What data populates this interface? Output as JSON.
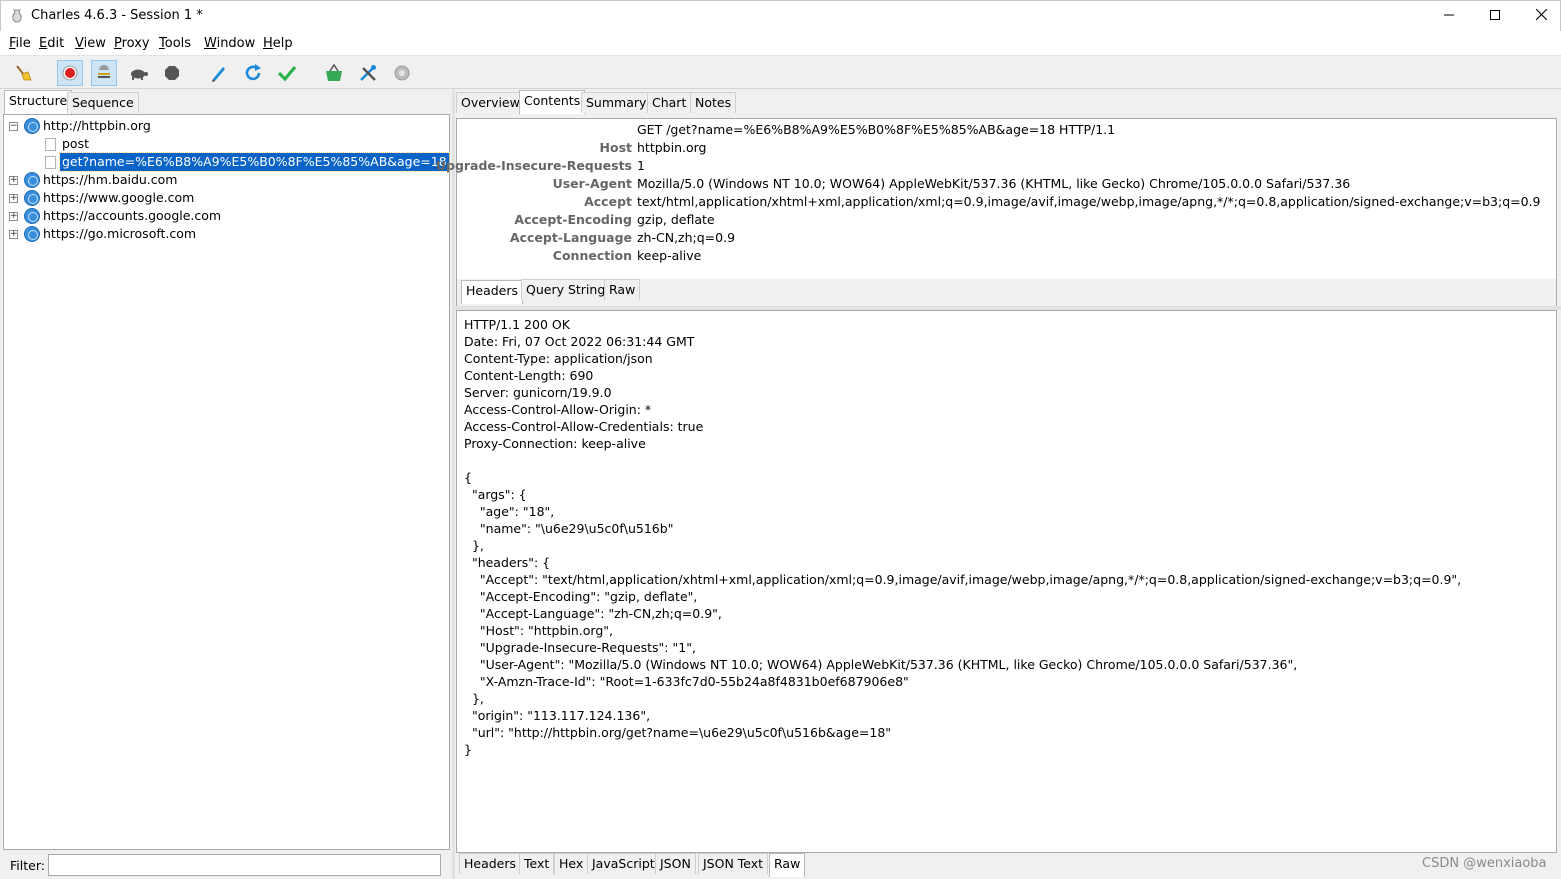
{
  "window": {
    "title": "Charles 4.6.3 - Session 1 *",
    "controls": [
      "minimize",
      "maximize",
      "close"
    ]
  },
  "menubar": [
    "File",
    "Edit",
    "View",
    "Proxy",
    "Tools",
    "Window",
    "Help"
  ],
  "toolbar": {
    "icons": [
      "broom-icon",
      "record-icon",
      "throttle-icon",
      "turtle-icon",
      "stop-hexagon-icon",
      "pen-icon",
      "refresh-icon",
      "check-icon",
      "basket-icon",
      "tools-icon",
      "settings-gear-icon"
    ],
    "colors": {
      "record": "#e02020",
      "refresh": "#1a8ad9",
      "check": "#2bb34a",
      "basket": "#34a853"
    }
  },
  "left": {
    "tabs": [
      "Structure",
      "Sequence"
    ],
    "tree": [
      {
        "label": "http://httpbin.org",
        "expanded": true,
        "children": [
          {
            "label": "post"
          },
          {
            "label": "get?name=%E6%B8%A9%E5%B0%8F%E5%85%AB&age=18",
            "selected": true
          }
        ]
      },
      {
        "label": "https://hm.baidu.com"
      },
      {
        "label": "https://www.google.com"
      },
      {
        "label": "https://accounts.google.com"
      },
      {
        "label": "https://go.microsoft.com"
      }
    ],
    "filter_label": "Filter:",
    "filter_value": ""
  },
  "right": {
    "tabs": [
      "Overview",
      "Contents",
      "Summary",
      "Chart",
      "Notes"
    ],
    "selected_tab": "Contents",
    "request_line": "GET /get?name=%E6%B8%A9%E5%B0%8F%E5%85%AB&age=18 HTTP/1.1",
    "request_headers": [
      {
        "key": "Host",
        "value": "httpbin.org"
      },
      {
        "key": "Upgrade-Insecure-Requests",
        "value": "1"
      },
      {
        "key": "User-Agent",
        "value": "Mozilla/5.0 (Windows NT 10.0; WOW64) AppleWebKit/537.36 (KHTML, like Gecko) Chrome/105.0.0.0 Safari/537.36"
      },
      {
        "key": "Accept",
        "value": "text/html,application/xhtml+xml,application/xml;q=0.9,image/avif,image/webp,image/apng,*/*;q=0.8,application/signed-exchange;v=b3;q=0.9"
      },
      {
        "key": "Accept-Encoding",
        "value": "gzip, deflate"
      },
      {
        "key": "Accept-Language",
        "value": "zh-CN,zh;q=0.9"
      },
      {
        "key": "Connection",
        "value": "keep-alive"
      }
    ],
    "request_subtabs": [
      "Headers",
      "Query String",
      "Raw"
    ],
    "request_subtab_selected": "Headers",
    "response_lines": [
      "HTTP/1.1 200 OK",
      "Date: Fri, 07 Oct 2022 06:31:44 GMT",
      "Content-Type: application/json",
      "Content-Length: 690",
      "Server: gunicorn/19.9.0",
      "Access-Control-Allow-Origin: *",
      "Access-Control-Allow-Credentials: true",
      "Proxy-Connection: keep-alive",
      "",
      "{",
      "  \"args\": {",
      "    \"age\": \"18\",",
      "    \"name\": \"\\u6e29\\u5c0f\\u516b\"",
      "  },",
      "  \"headers\": {",
      "    \"Accept\": \"text/html,application/xhtml+xml,application/xml;q=0.9,image/avif,image/webp,image/apng,*/*;q=0.8,application/signed-exchange;v=b3;q=0.9\",",
      "    \"Accept-Encoding\": \"gzip, deflate\",",
      "    \"Accept-Language\": \"zh-CN,zh;q=0.9\",",
      "    \"Host\": \"httpbin.org\",",
      "    \"Upgrade-Insecure-Requests\": \"1\",",
      "    \"User-Agent\": \"Mozilla/5.0 (Windows NT 10.0; WOW64) AppleWebKit/537.36 (KHTML, like Gecko) Chrome/105.0.0.0 Safari/537.36\",",
      "    \"X-Amzn-Trace-Id\": \"Root=1-633fc7d0-55b24a8f4831b0ef687906e8\"",
      "  },",
      "  \"origin\": \"113.117.124.136\",",
      "  \"url\": \"http://httpbin.org/get?name=\\u6e29\\u5c0f\\u516b&age=18\"",
      "}"
    ],
    "response_subtabs": [
      "Headers",
      "Text",
      "Hex",
      "JavaScript",
      "JSON",
      "JSON Text",
      "Raw"
    ],
    "response_subtab_selected": "Raw"
  },
  "watermark": "CSDN @wenxiaoba"
}
